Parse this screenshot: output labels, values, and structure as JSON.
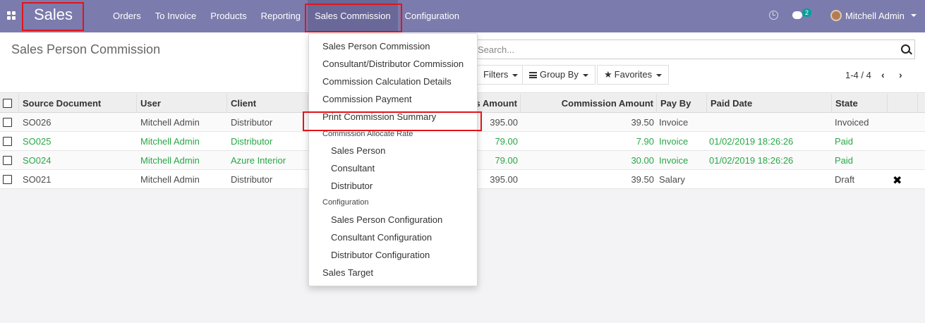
{
  "navbar": {
    "brand": "Sales",
    "menu": [
      "Orders",
      "To Invoice",
      "Products",
      "Reporting",
      "Sales Commission",
      "Configuration"
    ],
    "active_menu": "Sales Commission",
    "message_count": "2",
    "user": "Mitchell Admin",
    "color": "#7c7bad"
  },
  "control": {
    "title": "Sales Person Commission",
    "search_placeholder": "Search...",
    "filters": "Filters",
    "group_by": "Group By",
    "favorites": "Favorites",
    "pager": "1-4 / 4"
  },
  "table": {
    "columns": [
      "Source Document",
      "User",
      "Client",
      "s Amount",
      "Commission Amount",
      "Pay By",
      "Paid Date",
      "State"
    ],
    "rows": [
      {
        "doc": "SO026",
        "user": "Mitchell Admin",
        "client": "Distributor",
        "amount": "395.00",
        "commission": "39.50",
        "pay_by": "Invoice",
        "paid_date": "",
        "state": "Invoiced",
        "highlight": false
      },
      {
        "doc": "SO025",
        "user": "Mitchell Admin",
        "client": "Distributor",
        "amount": "79.00",
        "commission": "7.90",
        "pay_by": "Invoice",
        "paid_date": "01/02/2019 18:26:26",
        "state": "Paid",
        "highlight": true
      },
      {
        "doc": "SO024",
        "user": "Mitchell Admin",
        "client": "Azure Interior",
        "amount": "79.00",
        "commission": "30.00",
        "pay_by": "Invoice",
        "paid_date": "01/02/2019 18:26:26",
        "state": "Paid",
        "highlight": true
      },
      {
        "doc": "SO021",
        "user": "Mitchell Admin",
        "client": "Distributor",
        "amount": "395.00",
        "commission": "39.50",
        "pay_by": "Salary",
        "paid_date": "",
        "state": "Draft",
        "highlight": false
      }
    ],
    "highlight_color": "#28a745"
  },
  "dropdown": {
    "items": [
      "Sales Person Commission",
      "Consultant/Distributor Commission",
      "Commission Calculation Details",
      "Commission Payment",
      "Print Commission Summary"
    ],
    "header_rate": "Commission Allocate Rate",
    "rate_items": [
      "Sales Person",
      "Consultant",
      "Distributor"
    ],
    "header_config": "Configuration",
    "config_items": [
      "Sales Person Configuration",
      "Consultant Configuration",
      "Distributor Configuration"
    ],
    "last_item": "Sales Target"
  },
  "annotation_color": "#e0151b"
}
